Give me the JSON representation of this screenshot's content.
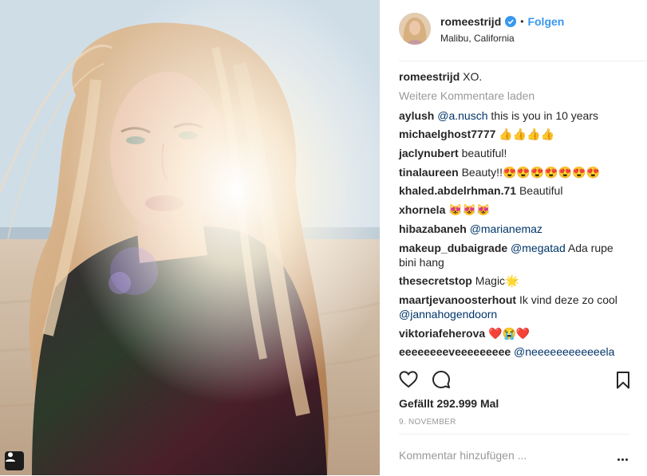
{
  "post": {
    "username": "romeestrijd",
    "verified": true,
    "separator": "•",
    "follow_label": "Folgen",
    "location": "Malibu, California",
    "caption": {
      "user": "romeestrijd",
      "text": "XO."
    },
    "more_comments_label": "Weitere Kommentare laden",
    "likes": "Gefällt 292.999 Mal",
    "date": "9. NOVEMBER",
    "comment_placeholder": "Kommentar hinzufügen ...",
    "comments": [
      {
        "user": "aylush",
        "parts": [
          {
            "t": "mention",
            "v": "@a.nusch"
          },
          {
            "t": "text",
            "v": " this is you in 10 years"
          }
        ]
      },
      {
        "user": "michaelghost7777",
        "parts": [
          {
            "t": "text",
            "v": "👍👍👍👍"
          }
        ]
      },
      {
        "user": "jaclynubert",
        "parts": [
          {
            "t": "text",
            "v": "beautiful!"
          }
        ]
      },
      {
        "user": "tinalaureen",
        "parts": [
          {
            "t": "text",
            "v": "Beauty!!😍😍😍😍😍😍😍"
          }
        ]
      },
      {
        "user": "khaled.abdelrhman.71",
        "parts": [
          {
            "t": "text",
            "v": "Beautiful"
          }
        ]
      },
      {
        "user": "xhornela",
        "parts": [
          {
            "t": "text",
            "v": "😻😻😻"
          }
        ]
      },
      {
        "user": "hibazabaneh",
        "parts": [
          {
            "t": "mention",
            "v": "@marianemaz"
          }
        ]
      },
      {
        "user": "makeup_dubaigrade",
        "parts": [
          {
            "t": "mention",
            "v": "@megatad"
          },
          {
            "t": "text",
            "v": " Ada rupe bini hang"
          }
        ]
      },
      {
        "user": "thesecretstop",
        "parts": [
          {
            "t": "text",
            "v": "Magic🌟"
          }
        ]
      },
      {
        "user": "maartjevanoosterhout",
        "parts": [
          {
            "t": "text",
            "v": "Ik vind deze zo cool "
          },
          {
            "t": "mention",
            "v": "@jannahogendoorn"
          }
        ]
      },
      {
        "user": "viktoriafeherova",
        "parts": [
          {
            "t": "text",
            "v": "❤️😭❤️"
          }
        ]
      },
      {
        "user": "eeeeeeeeveeeeeeeee",
        "parts": [
          {
            "t": "mention",
            "v": "@neeeeeeeeeeeela"
          }
        ]
      }
    ]
  },
  "colors": {
    "accent": "#3897f0",
    "text": "#262626",
    "muted": "#999999",
    "mention": "#003569",
    "divider": "#efefef"
  },
  "icons": {
    "verified": "verified-badge-icon",
    "like": "heart-outline-icon",
    "comment": "speech-bubble-icon",
    "save": "bookmark-icon",
    "tag": "user-tag-icon",
    "options": "ellipsis-icon"
  }
}
